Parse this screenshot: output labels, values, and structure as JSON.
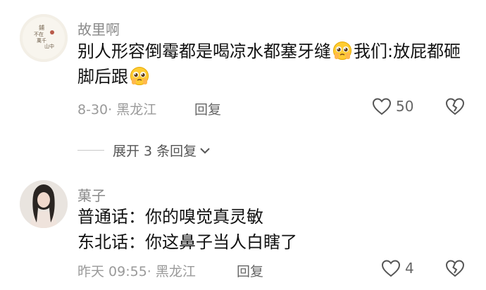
{
  "comments": [
    {
      "username": "故里啊",
      "text_part1": "别人形容倒霉都是喝凉水都塞牙缝",
      "text_part2": "我们:放屁都砸脚后跟",
      "date": "8-30",
      "location": "黑龙江",
      "reply_label": "回复",
      "likes": "50",
      "emoji": "pleading-face-icon"
    },
    {
      "username": "菓子",
      "line1": "普通话：你的嗅觉真灵敏",
      "line2": "东北话：你这鼻子当人白瞎了",
      "date": "昨天 09:55",
      "location": "黑龙江",
      "reply_label": "回复",
      "likes": "4"
    }
  ],
  "expand_replies_label": "展开 3 条回复",
  "colors": {
    "meta": "#9a9a9a",
    "username": "#8a8a8a",
    "text": "#111111"
  }
}
